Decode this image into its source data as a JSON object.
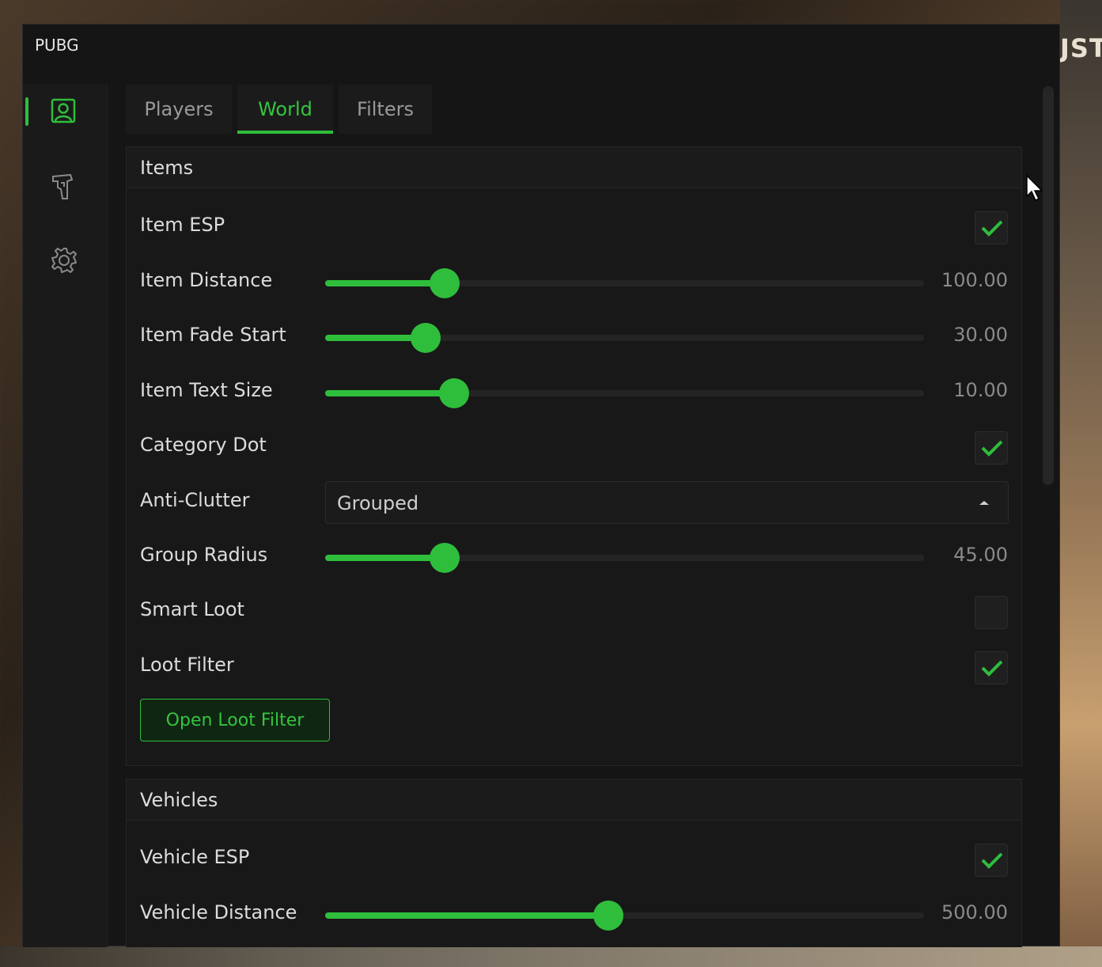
{
  "background": {
    "right_text": "JSTO"
  },
  "window": {
    "title": "PUBG"
  },
  "sidebar": {
    "items": [
      {
        "icon": "player-icon",
        "active": true
      },
      {
        "icon": "pistol-icon",
        "active": false
      },
      {
        "icon": "gear-icon",
        "active": false
      }
    ]
  },
  "tabs": [
    {
      "label": "Players",
      "active": false
    },
    {
      "label": "World",
      "active": true
    },
    {
      "label": "Filters",
      "active": false
    }
  ],
  "items_section": {
    "title": "Items",
    "item_esp": {
      "label": "Item ESP",
      "checked": true
    },
    "item_distance": {
      "label": "Item Distance",
      "value": "100.00",
      "fraction": 0.2
    },
    "item_fade_start": {
      "label": "Item Fade Start",
      "value": "30.00",
      "fraction": 0.168
    },
    "item_text_size": {
      "label": "Item Text Size",
      "value": "10.00",
      "fraction": 0.215
    },
    "category_dot": {
      "label": "Category Dot",
      "checked": true
    },
    "anti_clutter": {
      "label": "Anti-Clutter",
      "selected": "Grouped"
    },
    "group_radius": {
      "label": "Group Radius",
      "value": "45.00",
      "fraction": 0.2
    },
    "smart_loot": {
      "label": "Smart Loot",
      "checked": false
    },
    "loot_filter": {
      "label": "Loot Filter",
      "checked": true
    },
    "open_loot_filter_button": "Open Loot Filter"
  },
  "vehicles_section": {
    "title": "Vehicles",
    "vehicle_esp": {
      "label": "Vehicle ESP",
      "checked": true
    },
    "vehicle_distance": {
      "label": "Vehicle Distance",
      "value": "500.00",
      "fraction": 0.473
    }
  },
  "colors": {
    "accent": "#2fbe3c",
    "panel": "#181818",
    "window": "#151515"
  }
}
